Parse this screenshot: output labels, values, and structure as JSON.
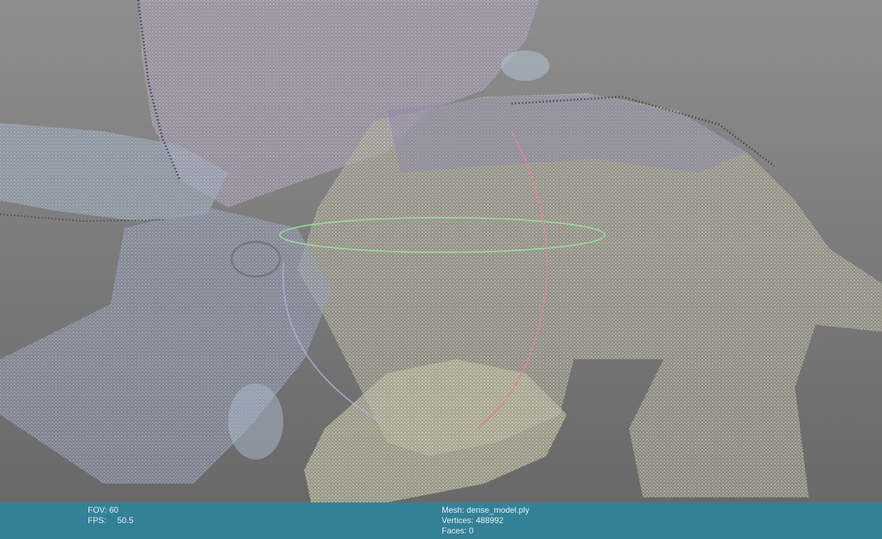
{
  "viewer": {
    "background_top": "#8e8e8e",
    "background_bottom": "#666666",
    "gizmo_colors": {
      "x_axis_ring": "#d98a92",
      "y_axis_ring": "#9be09b",
      "z_axis_ring": "#b8a6d8"
    }
  },
  "camera_info": {
    "fov_label": "FOV:",
    "fov_value": "60",
    "fps_label": "FPS:",
    "fps_value": "50.5"
  },
  "mesh_info": {
    "mesh_label": "Mesh:",
    "mesh_value": "dense_model.ply",
    "vertices_label": "Vertices:",
    "vertices_value": "488992",
    "faces_label": "Faces:",
    "faces_value": "0"
  },
  "info_bar_color": "#2c849e"
}
